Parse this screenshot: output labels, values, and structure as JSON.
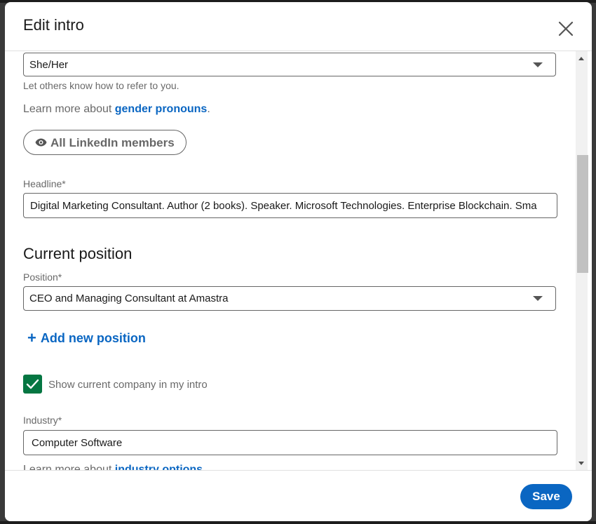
{
  "dialog": {
    "title": "Edit intro",
    "close_icon": "close-icon"
  },
  "pronouns": {
    "value": "She/Her",
    "helper": "Let others know how to refer to you.",
    "learn_more_prefix": "Learn more about ",
    "learn_more_link": "gender pronouns",
    "learn_more_suffix": ".",
    "visibility_icon": "eye-icon",
    "visibility_label": "All LinkedIn members"
  },
  "headline": {
    "label": "Headline*",
    "value": "Digital Marketing Consultant. Author (2 books). Speaker. Microsoft Technologies. Enterprise Blockchain. Sma"
  },
  "current_position": {
    "heading": "Current position",
    "position_label": "Position*",
    "position_value": "CEO and Managing Consultant at Amastra",
    "add_new_position": "Add new position",
    "show_company_checked": true,
    "show_company_label": "Show current company in my intro"
  },
  "industry": {
    "label": "Industry*",
    "value": "Computer Software",
    "learn_more_prefix": "Learn more about ",
    "learn_more_link": "industry options"
  },
  "footer": {
    "save_label": "Save"
  },
  "colors": {
    "primary": "#0a66c2",
    "checkbox": "#057642"
  }
}
